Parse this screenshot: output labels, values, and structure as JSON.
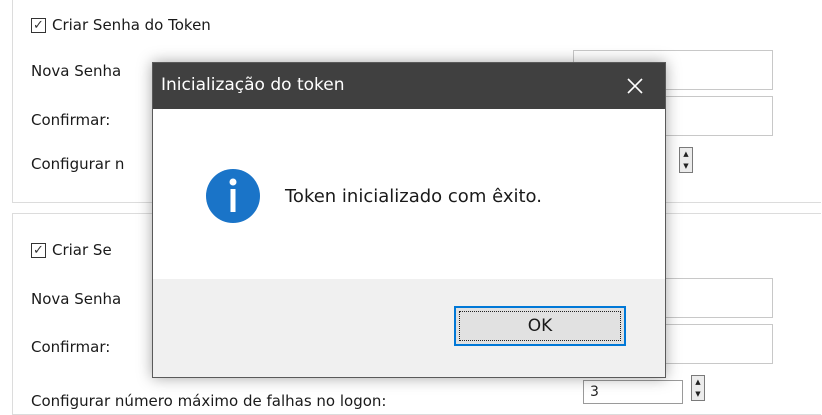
{
  "section_top": {
    "checkbox_checked": true,
    "title": "Criar Senha do Token",
    "new_password_label": "Nova Senha",
    "confirm_label": "Confirmar:",
    "config_label": "Configurar n"
  },
  "section_bottom": {
    "checkbox_checked": true,
    "title": "Criar  Se",
    "new_password_label": "Nova Senha",
    "confirm_label": "Confirmar:",
    "config_label": "Configurar número máximo de falhas no logon:",
    "max_failures_value": "3"
  },
  "dialog": {
    "title": "Inicialização do token",
    "close_glyph": "×",
    "icon": "info-icon",
    "icon_color": "#1a74c8",
    "message": "Token inicializado com êxito.",
    "ok_label": "OK"
  }
}
